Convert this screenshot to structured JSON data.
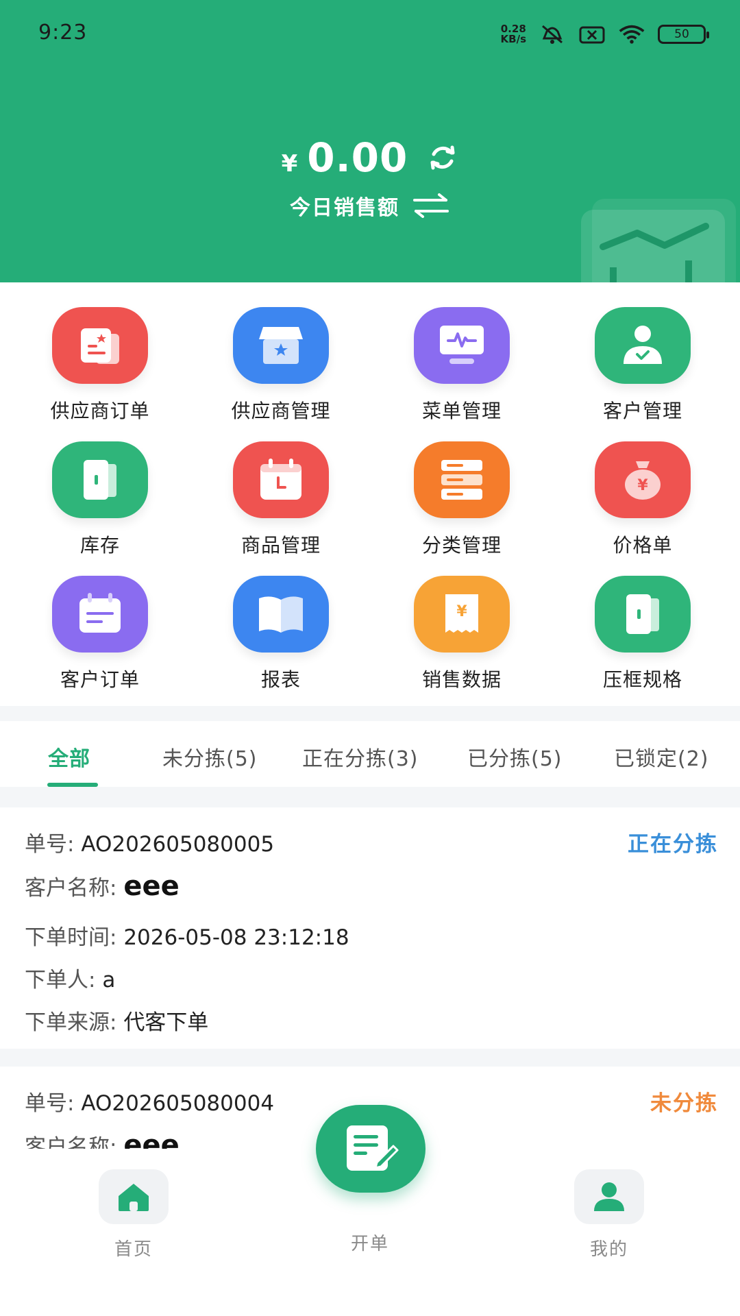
{
  "status_bar": {
    "time": "9:23",
    "net_speed_value": "0.28",
    "net_speed_unit": "KB/s",
    "battery": "50"
  },
  "header": {
    "currency": "¥",
    "amount": "0.00",
    "label": "今日销售额"
  },
  "menu": {
    "items": [
      {
        "label": "供应商订单",
        "icon": "supplier-order-icon",
        "color": "#ef5350"
      },
      {
        "label": "供应商管理",
        "icon": "supplier-store-icon",
        "color": "#3d86f0"
      },
      {
        "label": "菜单管理",
        "icon": "menu-monitor-icon",
        "color": "#8a6cf0"
      },
      {
        "label": "客户管理",
        "icon": "customer-icon",
        "color": "#2fb57a"
      },
      {
        "label": "库存",
        "icon": "inventory-door-icon",
        "color": "#2fb57a"
      },
      {
        "label": "商品管理",
        "icon": "product-calendar-icon",
        "color": "#ef5350"
      },
      {
        "label": "分类管理",
        "icon": "category-server-icon",
        "color": "#f57c2b"
      },
      {
        "label": "价格单",
        "icon": "price-bag-icon",
        "color": "#ef5350"
      },
      {
        "label": "客户订单",
        "icon": "customer-order-icon",
        "color": "#8a6cf0"
      },
      {
        "label": "报表",
        "icon": "report-book-icon",
        "color": "#3d86f0"
      },
      {
        "label": "销售数据",
        "icon": "sales-receipt-icon",
        "color": "#f7a336"
      },
      {
        "label": "压框规格",
        "icon": "frame-spec-icon",
        "color": "#2fb57a"
      }
    ]
  },
  "tabs": [
    {
      "label": "全部"
    },
    {
      "label": "未分拣(5)"
    },
    {
      "label": "正在分拣(3)"
    },
    {
      "label": "已分拣(5)"
    },
    {
      "label": "已锁定(2)"
    }
  ],
  "orders": [
    {
      "number_label": "单号:",
      "number": "AO202605080005",
      "status": "正在分拣",
      "status_color": "#3a8fd9",
      "customer_label": "客户名称:",
      "customer": "eee",
      "time_label": "下单时间:",
      "time": "2026-05-08 23:12:18",
      "person_label": "下单人:",
      "person": "a",
      "source_label": "下单来源:",
      "source": "代客下单"
    },
    {
      "number_label": "单号:",
      "number": "AO202605080004",
      "status": "未分拣",
      "status_color": "#f08a3c",
      "customer_label": "客户名称:",
      "customer": "eee"
    }
  ],
  "bottom_nav": {
    "home": "首页",
    "create": "开单",
    "mine": "我的"
  },
  "colors": {
    "brand": "#25ad78"
  }
}
